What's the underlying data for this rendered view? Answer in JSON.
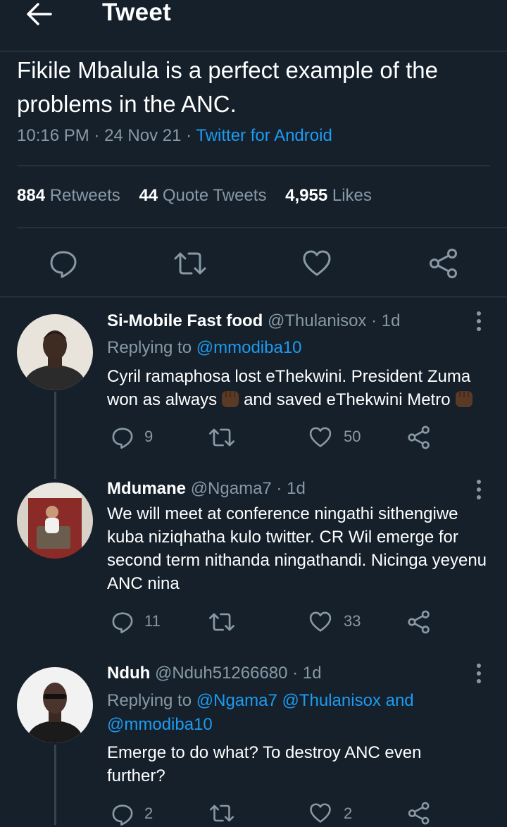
{
  "header": {
    "title": "Tweet",
    "back_icon": "arrow-left-icon"
  },
  "tweet": {
    "text": "Fikile Mbalula is a perfect example of the problems in the ANC.",
    "time": "10:16 PM",
    "dot1": " · ",
    "date": "24 Nov 21",
    "dot2": " · ",
    "source": "Twitter for Android"
  },
  "stats": {
    "retweets_count": "884",
    "retweets_label": "Retweets",
    "quotes_count": "44",
    "quotes_label": "Quote Tweets",
    "likes_count": "4,955",
    "likes_label": "Likes"
  },
  "actions": [
    "reply-icon",
    "retweet-icon",
    "like-icon",
    "share-icon"
  ],
  "colors": {
    "background": "#15202b",
    "accent": "#1d9bf0",
    "muted": "#8899a6",
    "divider": "#38444d"
  },
  "replies": [
    {
      "name": "Si-Mobile Fast food",
      "handle": "@Thulanisox",
      "sep": " · ",
      "age": "1d",
      "replying_prefix": "Replying to",
      "replying_to": "@mmodiba10",
      "text_a": "Cyril ramaphosa lost eThekwini. President Zuma won as always",
      "text_b": "and saved eThekwini Metro",
      "reply_count": "9",
      "like_count": "50"
    },
    {
      "name": "Mdumane",
      "handle": "@Ngama7",
      "sep": " · ",
      "age": "1d",
      "text": "We will meet at conference ningathi sithengiwe kuba niziqhatha kulo twitter. CR Wil emerge for second term nithanda ningathandi. Nicinga yeyenu ANC nina",
      "reply_count": "11",
      "like_count": "33"
    },
    {
      "name": "Nduh",
      "handle": "@Nduh51266680",
      "sep": " · ",
      "age": "1d",
      "replying_prefix": "Replying to",
      "replying_to_1": "@Ngama7",
      "replying_to_2": "@Thulanisox",
      "replying_and": "and",
      "replying_to_3": "@mmodiba10",
      "text": "Emerge to do what? To destroy ANC even further?",
      "reply_count": "2",
      "like_count": "2"
    }
  ]
}
